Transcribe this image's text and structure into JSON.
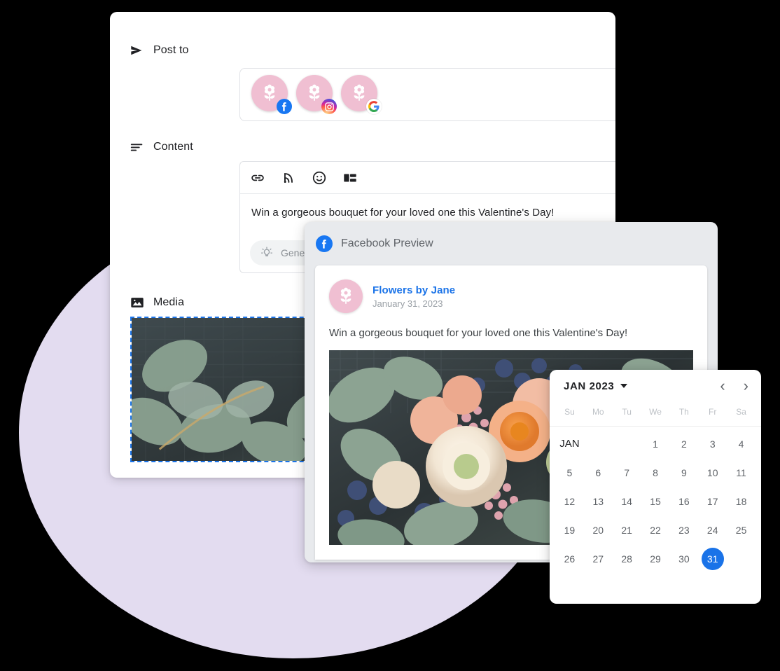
{
  "composer": {
    "post_to": {
      "label": "Post to",
      "icon": "send-icon",
      "accounts": [
        {
          "name": "Flowers by Jane",
          "network": "facebook",
          "badge_icon": "facebook-icon"
        },
        {
          "name": "Flowers by Jane",
          "network": "instagram",
          "badge_icon": "instagram-icon"
        },
        {
          "name": "Flowers by Jane",
          "network": "google",
          "badge_icon": "google-icon"
        }
      ],
      "dropdown_icon": "chevron-down-icon"
    },
    "content": {
      "label": "Content",
      "icon": "text-lines-icon",
      "toolbar_icons": [
        "link-icon",
        "rss-icon",
        "emoji-icon",
        "layout-icon"
      ],
      "text": "Win a gorgeous bouquet for your loved one this Valentine's Day!",
      "generate_button": {
        "label": "Generate text",
        "icon": "lightbulb-icon",
        "caret_icon": "chevron-down-icon"
      }
    },
    "media": {
      "label": "Media",
      "icon": "image-icon",
      "alt": "bouquet of pale pink ranunculus with eucalyptus leaves"
    }
  },
  "facebook_preview": {
    "title": "Facebook Preview",
    "logo_icon": "facebook-icon",
    "post": {
      "page_name": "Flowers by Jane",
      "avatar_icon": "flower-icon",
      "date": "January 31, 2023",
      "text": "Win a gorgeous bouquet for your loved one this Valentine's Day!",
      "image_alt": "bouquet of ranunculus, blueberries and eucalyptus"
    }
  },
  "calendar": {
    "month_label": "JAN 2023",
    "month_dropdown_icon": "chevron-down-icon",
    "prev_icon": "chevron-left-icon",
    "next_icon": "chevron-right-icon",
    "weekdays": [
      "Su",
      "Mo",
      "Tu",
      "We",
      "Th",
      "Fr",
      "Sa"
    ],
    "month_short": "JAN",
    "weeks": [
      [
        "JAN",
        "",
        "",
        "1",
        "2",
        "3",
        "4"
      ],
      [
        "5",
        "6",
        "7",
        "8",
        "9",
        "10",
        "11"
      ],
      [
        "12",
        "13",
        "14",
        "15",
        "16",
        "17",
        "18"
      ],
      [
        "19",
        "20",
        "21",
        "22",
        "23",
        "24",
        "25"
      ],
      [
        "26",
        "27",
        "28",
        "29",
        "30",
        "31",
        ""
      ]
    ],
    "selected_day": "31",
    "selected_color": "#1a73e8"
  },
  "colors": {
    "background_circle": "#e3dcf0",
    "avatar_pink": "#f0bfd2",
    "facebook_blue": "#1877f2",
    "link_blue": "#1a73e8",
    "panel_white": "#ffffff",
    "preview_gray": "#e8eaed"
  }
}
